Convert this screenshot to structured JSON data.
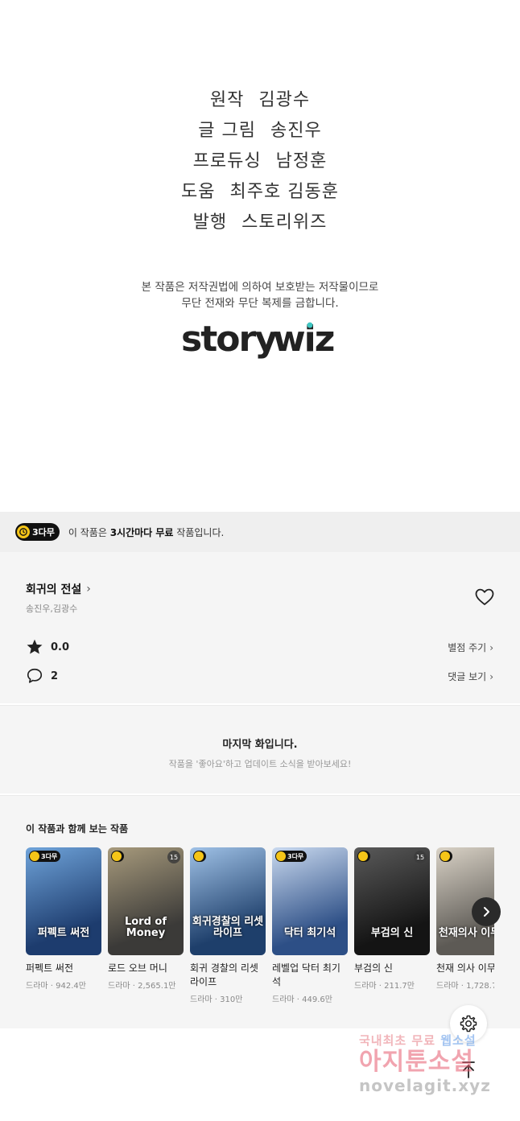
{
  "credits": {
    "lines": [
      {
        "role": "원작",
        "name": "김광수"
      },
      {
        "role": "글 그림",
        "name": "송진우"
      },
      {
        "role": "프로듀싱",
        "name": "남정훈"
      },
      {
        "role": "도움",
        "name": "최주호 김동훈"
      },
      {
        "role": "발행",
        "name": "스토리위즈"
      }
    ],
    "copyright_line1": "본 작품은 저작권법에 의하여 보호받는 저작물이므로",
    "copyright_line2": "무단 전재와 무단 복제를 금합니다.",
    "logo_text": "storywiz"
  },
  "free_banner": {
    "badge": "3다무",
    "text_prefix": "이 작품은 ",
    "text_bold": "3시간마다 무료",
    "text_suffix": " 작품입니다."
  },
  "work": {
    "title": "회귀의 전설",
    "authors": "송진우,김광수",
    "rating": "0.0",
    "rating_link": "별점 주기",
    "comments": "2",
    "comments_link": "댓글 보기"
  },
  "last_episode": {
    "title": "마지막 화입니다.",
    "subtitle": "작품을 '좋아요'하고 업데이트 소식을 받아보세요!"
  },
  "recommendations": {
    "heading": "이 작품과 함께 보는 작품",
    "items": [
      {
        "title": "퍼펙트 써전",
        "meta": "드라마 · 942.4만",
        "badge": "3다무",
        "age": "",
        "cover": "퍼펙트 써전",
        "color1": "#1d3c6e",
        "color2": "#6fa3d9"
      },
      {
        "title": "로드 오브 머니",
        "meta": "드라마 · 2,565.1만",
        "badge": "",
        "age": "15",
        "cover": "Lord of Money",
        "color1": "#3b3a38",
        "color2": "#a79a7c"
      },
      {
        "title": "회귀 경찰의 리셋 라이프",
        "meta": "드라마 · 310만",
        "badge": "",
        "age": "",
        "cover": "회귀경찰의 리셋라이프",
        "color1": "#1e3f6b",
        "color2": "#9fc1e6"
      },
      {
        "title": "레벨업 닥터 최기석",
        "meta": "드라마 · 449.6만",
        "badge": "3다무",
        "age": "",
        "cover": "닥터 최기석",
        "color1": "#2d4f86",
        "color2": "#c9d9ef"
      },
      {
        "title": "부검의 신",
        "meta": "드라마 · 211.7만",
        "badge": "",
        "age": "15",
        "cover": "부검의 신",
        "color1": "#141414",
        "color2": "#5a5a5a"
      },
      {
        "title": "천재 의사 이무",
        "meta": "드라마 · 1,728.7",
        "badge": "",
        "age": "",
        "cover": "천재의사 이무진",
        "color1": "#5d5a55",
        "color2": "#d9d2c6"
      }
    ]
  },
  "watermark": {
    "line1a": "국내최초 무료 ",
    "line1b": "웹소설",
    "line2": "아지툰소설",
    "line3": "novelagit.xyz"
  },
  "colors": {
    "badge_yellow": "#f5c518",
    "badge_black": "#111111",
    "section_bg": "#f5f5f5",
    "banner_bg": "#efefef"
  }
}
